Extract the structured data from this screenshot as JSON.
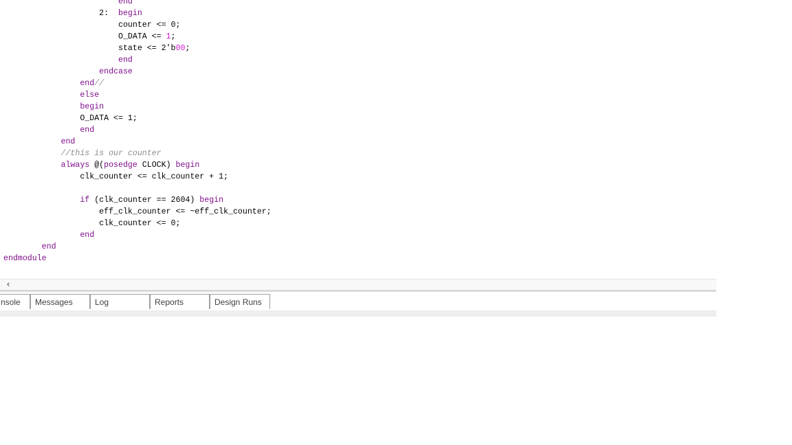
{
  "editor": {
    "lines": {
      "l00": {
        "indent": "                        ",
        "kw1": "end"
      },
      "l01": {
        "indent": "                    ",
        "t1": "2:  ",
        "kw1": "begin"
      },
      "l02": {
        "indent": "                        ",
        "t1": "counter <= 0;"
      },
      "l03": {
        "indent": "                        ",
        "t1": "O_DATA <= ",
        "n1": "1",
        "t2": ";"
      },
      "l04": {
        "indent": "                        ",
        "t1": "state <= 2'b",
        "n1": "00",
        "t2": ";"
      },
      "l05": {
        "indent": "                        ",
        "kw1": "end"
      },
      "l06": {
        "indent": "                    ",
        "kw1": "endcase"
      },
      "l07": {
        "indent": "                ",
        "kw1": "end",
        "c1": "//"
      },
      "l08": {
        "indent": "                ",
        "kw1": "else"
      },
      "l09": {
        "indent": "                ",
        "kw1": "begin"
      },
      "l10": {
        "indent": "                ",
        "t1": "O_DATA <= 1;"
      },
      "l11": {
        "indent": "                ",
        "kw1": "end"
      },
      "l12": {
        "indent": "            ",
        "kw1": "end"
      },
      "l13": {
        "indent": "            ",
        "c1": "//this is our counter"
      },
      "l14": {
        "indent": "            ",
        "kw1": "always",
        "t1": " @(",
        "kw2": "posedge",
        "t2": " CLOCK) ",
        "kw3": "begin"
      },
      "l15": {
        "indent": "                ",
        "t1": "clk_counter <= clk_counter + 1;"
      },
      "l16": {
        "indent": ""
      },
      "l17": {
        "indent": "                ",
        "kw1": "if",
        "t1": " (clk_counter == 2604) ",
        "kw2": "begin"
      },
      "l18": {
        "indent": "                    ",
        "t1": "eff_clk_counter <= ~eff_clk_counter;"
      },
      "l19": {
        "indent": "                    ",
        "t1": "clk_counter <= 0;"
      },
      "l20": {
        "indent": "                ",
        "kw1": "end"
      },
      "l21": {
        "indent": "        ",
        "kw1": "end"
      },
      "l22": {
        "indent": "",
        "kw1": "endmodule"
      }
    }
  },
  "scrollbar": {
    "left_arrow": "‹"
  },
  "tabs": {
    "console": "nsole",
    "messages": "Messages",
    "log": "Log",
    "reports": "Reports",
    "design_runs": "Design Runs"
  },
  "colors": {
    "keyword": "#7f0e8a",
    "comment": "#8c8c8c",
    "number": "#d11ad1",
    "text": "#000000"
  }
}
